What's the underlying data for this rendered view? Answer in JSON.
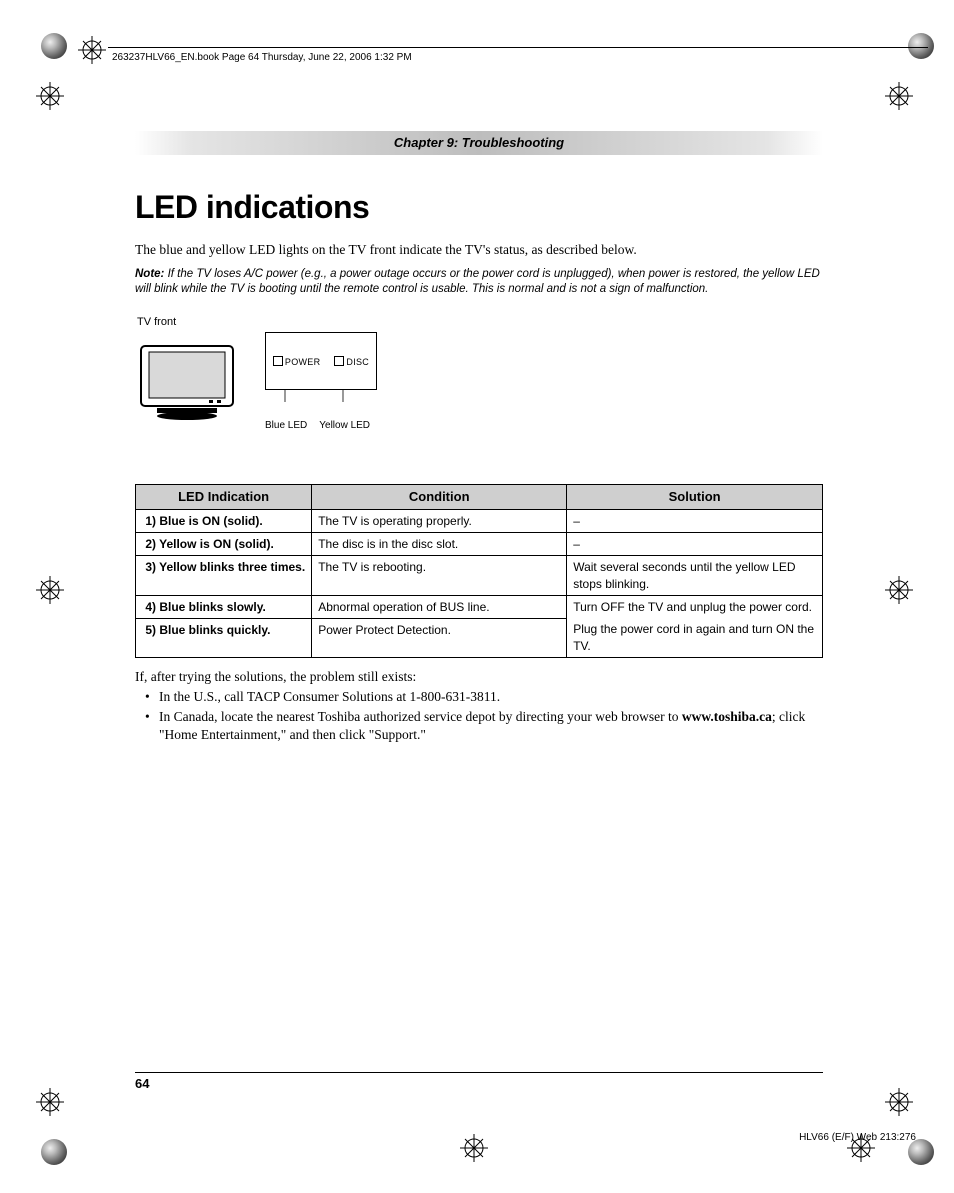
{
  "header": {
    "running": "263237HLV66_EN.book  Page 64  Thursday, June 22, 2006  1:32 PM"
  },
  "chapter": "Chapter 9: Troubleshooting",
  "title": "LED indications",
  "intro": "The blue and yellow LED lights on the TV front indicate the TV's status, as described below.",
  "note_label": "Note:",
  "note_body": "If the TV loses A/C power (e.g., a power outage occurs or the power cord is unplugged), when power is restored, the yellow LED will blink while the TV is booting until the remote control is usable. This is normal and is not a sign of malfunction.",
  "tv": {
    "front_label": "TV front",
    "power": "POWER",
    "disc": "DISC",
    "blue_led": "Blue LED",
    "yellow_led": "Yellow LED"
  },
  "table": {
    "headers": {
      "ind": "LED Indication",
      "cond": "Condition",
      "sol": "Solution"
    },
    "rows": [
      {
        "n": "1)",
        "ind": "Blue is ON (solid).",
        "cond": "The TV is operating properly.",
        "sol": "–"
      },
      {
        "n": "2)",
        "ind": "Yellow is ON (solid).",
        "cond": "The disc is in the disc slot.",
        "sol": "–"
      },
      {
        "n": "3)",
        "ind": "Yellow blinks three times.",
        "cond": "The TV is rebooting.",
        "sol": "Wait several seconds until the yellow LED stops blinking."
      },
      {
        "n": "4)",
        "ind": "Blue blinks slowly.",
        "cond": "Abnormal operation of BUS line.",
        "sol": "Turn OFF the TV and unplug the power cord."
      },
      {
        "n": "5)",
        "ind": "Blue blinks quickly.",
        "cond": "Power Protect Detection.",
        "sol": "Plug the power cord in again and turn ON the TV."
      }
    ]
  },
  "after": {
    "lead": "If, after trying the solutions, the problem still exists:",
    "b1": "In the U.S., call TACP Consumer Solutions at 1-800-631-3811.",
    "b2a": "In Canada, locate the nearest Toshiba authorized service depot by directing your web browser to ",
    "b2_bold": "www.toshiba.ca",
    "b2b": "; click \"Home Entertainment,\" and then click \"Support.\""
  },
  "page_number": "64",
  "footer_right": "HLV66 (E/F) Web 213:276"
}
